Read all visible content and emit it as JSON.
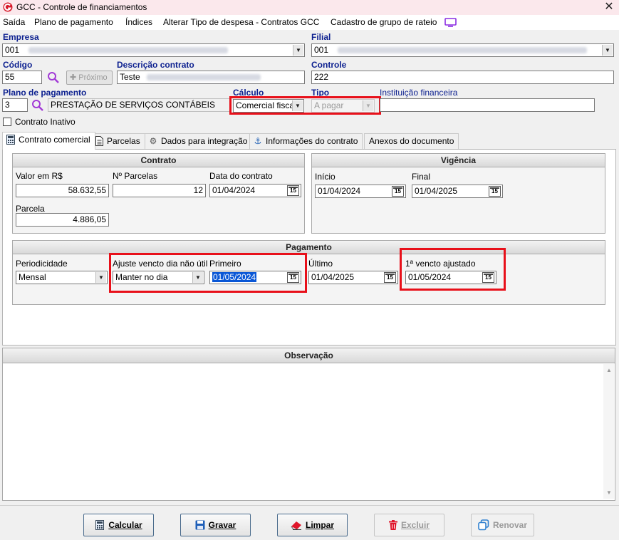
{
  "window": {
    "title": "GCC - Controle de financiamentos",
    "close_label": "✕"
  },
  "menu": {
    "items": [
      "Saída",
      "Plano de pagamento",
      "Índices",
      "Alterar Tipo de despesa - Contratos GCC",
      "Cadastro de grupo de rateio"
    ]
  },
  "header": {
    "empresa_label": "Empresa",
    "empresa_code": "001",
    "filial_label": "Filial",
    "filial_code": "001",
    "codigo_label": "Código",
    "codigo_value": "55",
    "proximo_label": "Próximo",
    "descricao_label": "Descrição contrato",
    "descricao_value": "Teste",
    "controle_label": "Controle",
    "controle_value": "222",
    "plano_label": "Plano de pagamento",
    "plano_code": "3",
    "plano_desc": "PRESTAÇÃO DE SERVIÇOS CONTÁBEIS",
    "calculo_label": "Cálculo",
    "calculo_value": "Comercial fiscal",
    "tipo_label": "Tipo",
    "tipo_value": "A pagar",
    "instituicao_label": "Instituição financeira",
    "inativo_label": "Contrato Inativo"
  },
  "tabs": [
    {
      "label": "Contrato comercial",
      "icon": "calculator-icon"
    },
    {
      "label": "Parcelas",
      "icon": "document-icon"
    },
    {
      "label": "Dados para integração",
      "icon": "gears-icon"
    },
    {
      "label": "Informações do contrato",
      "icon": "anchor-icon"
    },
    {
      "label": "Anexos do documento",
      "icon": ""
    }
  ],
  "contrato": {
    "title": "Contrato",
    "valor_label": "Valor em R$",
    "valor_value": "58.632,55",
    "nparcelas_label": "Nº Parcelas",
    "nparcelas_value": "12",
    "data_label": "Data do contrato",
    "data_value": "01/04/2024",
    "parcela_label": "Parcela",
    "parcela_value": "4.886,05"
  },
  "vigencia": {
    "title": "Vigência",
    "inicio_label": "Início",
    "inicio_value": "01/04/2024",
    "final_label": "Final",
    "final_value": "01/04/2025"
  },
  "pagamento": {
    "title": "Pagamento",
    "periodicidade_label": "Periodicidade",
    "periodicidade_value": "Mensal",
    "ajuste_label": "Ajuste vencto dia não útil",
    "ajuste_value": "Manter no dia",
    "primeiro_label": "Primeiro",
    "primeiro_value": "01/05/2024",
    "ultimo_label": "Último",
    "ultimo_value": "01/04/2025",
    "vencto_label": "1ª vencto ajustado",
    "vencto_value": "01/05/2024"
  },
  "observacao": {
    "title": "Observação"
  },
  "calendar_glyph": "15",
  "buttons": {
    "calcular": "Calcular",
    "gravar": "Gravar",
    "limpar": "Limpar",
    "excluir": "Excluir",
    "renovar": "Renovar"
  },
  "colors": {
    "label_blue": "#0b1f8f",
    "highlight_red": "#e8101a",
    "title_bg": "#fbe8ec",
    "selection": "#0a57d6"
  }
}
